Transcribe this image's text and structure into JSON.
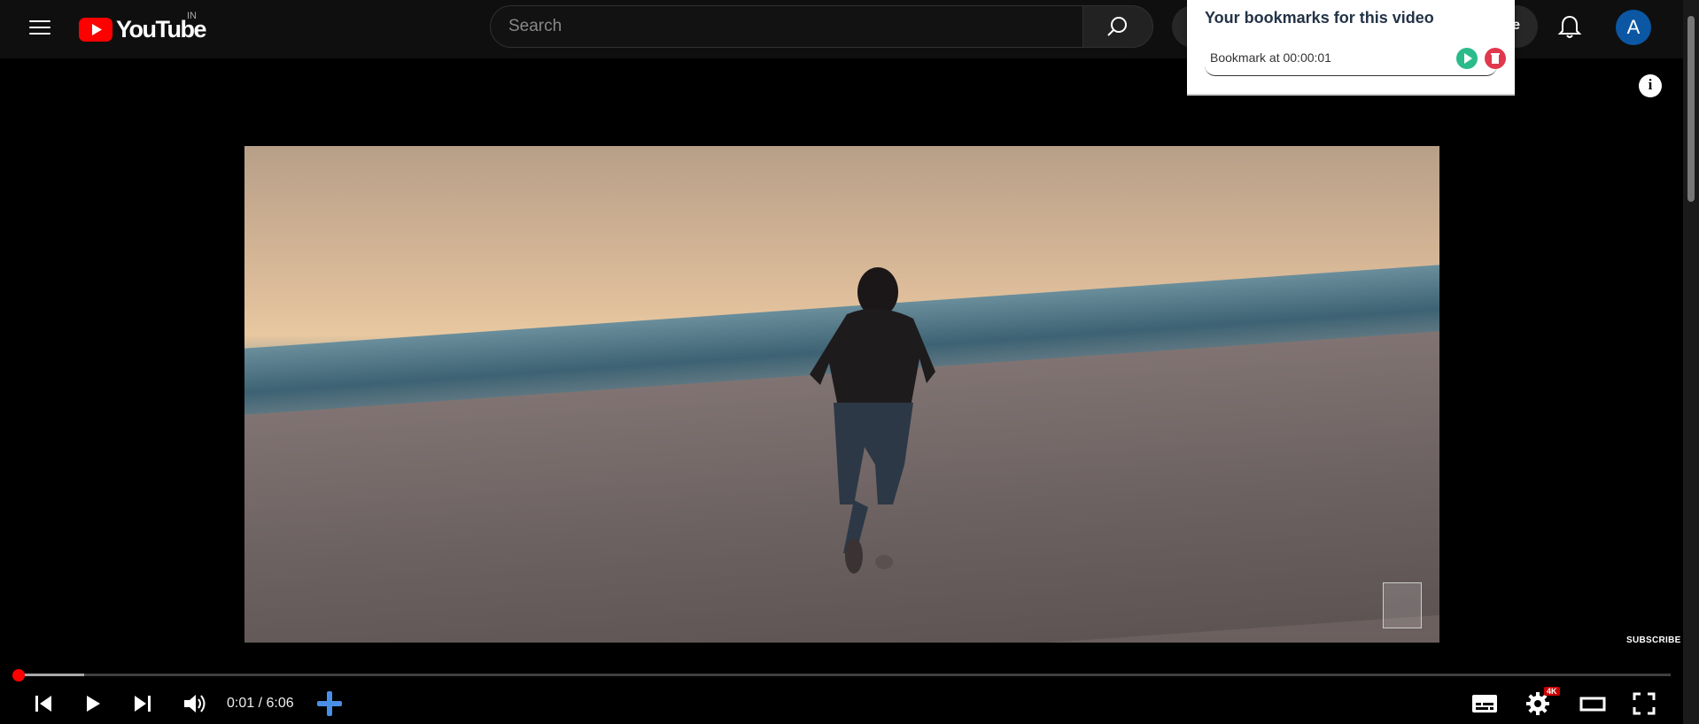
{
  "header": {
    "logo_text": "YouTube",
    "country_code": "IN",
    "search_placeholder": "Search",
    "create_label": "e",
    "avatar_letter": "A"
  },
  "bookmark_popup": {
    "title": "Your bookmarks for this video",
    "items": [
      {
        "label": "Bookmark at 00:00:01"
      }
    ]
  },
  "player": {
    "time_display": "0:01 / 6:06",
    "played_fraction": 0.003,
    "buffered_fraction": 0.04,
    "subscribe_label": "SUBSCRIBE",
    "quality_badge": "4K"
  },
  "colors": {
    "accent_red": "#ff0000",
    "bookmark_play": "#2bbb8b",
    "bookmark_delete": "#e0384d",
    "avatar_bg": "#0b57a4",
    "add_bookmark_icon": "#4a8fe7"
  },
  "icons": [
    "menu-icon",
    "youtube-logo-icon",
    "search-icon",
    "bell-icon",
    "info-icon",
    "previous-icon",
    "play-icon",
    "next-icon",
    "volume-icon",
    "add-bookmark-icon",
    "subtitles-icon",
    "settings-icon",
    "theater-mode-icon",
    "fullscreen-icon"
  ]
}
